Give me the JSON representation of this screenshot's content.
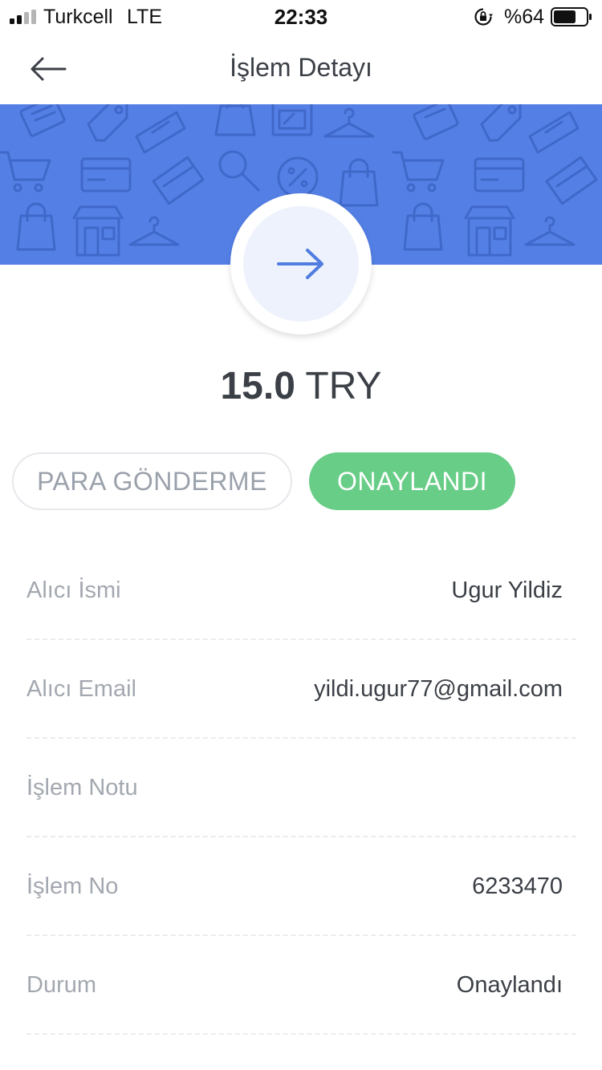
{
  "status_bar": {
    "carrier": "Turkcell",
    "network": "LTE",
    "time": "22:33",
    "battery_percent": "%64"
  },
  "nav": {
    "title": "İşlem Detayı",
    "back_icon": "arrow-left-icon"
  },
  "hero": {
    "icon": "arrow-right-icon",
    "amount_value": "15.0",
    "amount_currency": "TRY"
  },
  "tags": {
    "type_label": "PARA GÖNDERME",
    "status_label": "ONAYLANDI"
  },
  "details": [
    {
      "label": "Alıcı İsmi",
      "value": "Ugur Yildiz"
    },
    {
      "label": "Alıcı Email",
      "value": "yildi.ugur77@gmail.com"
    },
    {
      "label": "İşlem Notu",
      "value": ""
    },
    {
      "label": "İşlem No",
      "value": "6233470"
    },
    {
      "label": "Durum",
      "value": "Onaylandı"
    }
  ],
  "colors": {
    "banner": "#5480e6",
    "accent_blue": "#4f7de0",
    "status_green": "#68cd86",
    "text_dark": "#3b3f46",
    "text_muted": "#a3a8b0"
  }
}
